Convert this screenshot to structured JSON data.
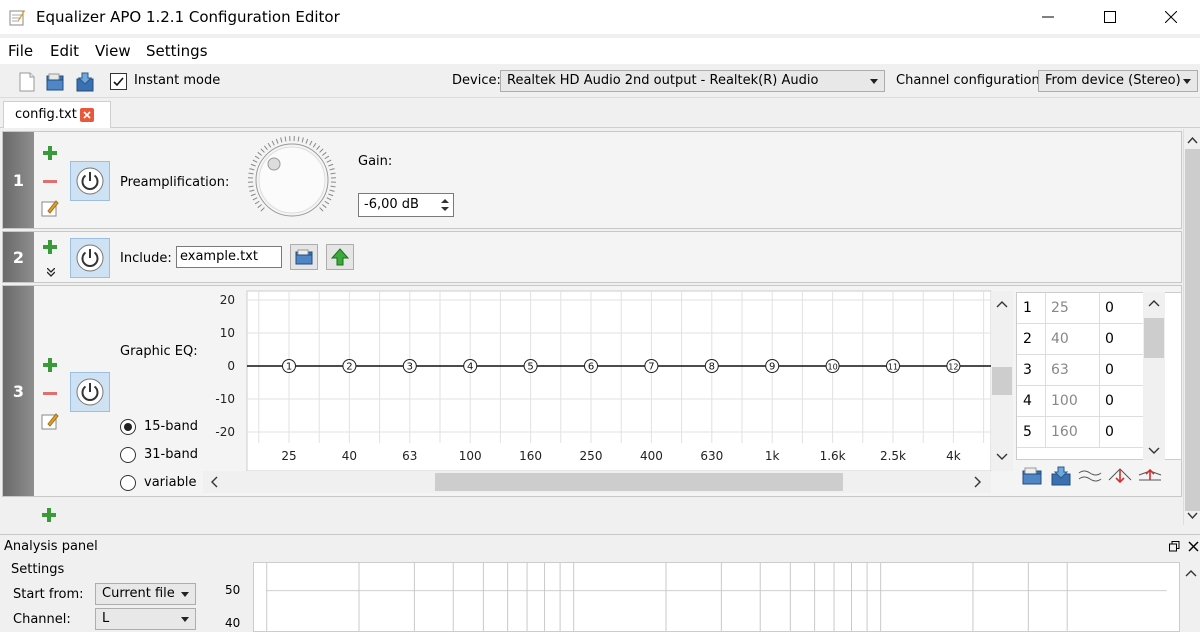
{
  "window": {
    "title": "Equalizer APO 1.2.1 Configuration Editor"
  },
  "menu": {
    "file": "File",
    "edit": "Edit",
    "view": "View",
    "settings": "Settings"
  },
  "toolbar": {
    "instant_mode": "Instant mode",
    "instant_mode_checked": true,
    "device_label": "Device:",
    "device_value": "Realtek HD Audio 2nd output - Realtek(R) Audio",
    "channel_label": "Channel configuration:",
    "channel_value": "From device (Stereo)"
  },
  "tabs": [
    {
      "label": "config.txt"
    }
  ],
  "filters": {
    "row1": {
      "number": "1",
      "label": "Preamplification:",
      "gain_label": "Gain:",
      "gain_value": "-6,00 dB"
    },
    "row2": {
      "number": "2",
      "label": "Include:",
      "file_value": "example.txt"
    },
    "row3": {
      "number": "3",
      "label": "Graphic EQ:",
      "modes": [
        "15-band",
        "31-band",
        "variable"
      ],
      "selected_mode": "15-band",
      "y_ticks": [
        "20",
        "10",
        "0",
        "-10",
        "-20"
      ],
      "x_ticks": [
        "25",
        "40",
        "63",
        "100",
        "160",
        "250",
        "400",
        "630",
        "1k",
        "1.6k",
        "2.5k",
        "4k"
      ],
      "markers": [
        "1",
        "2",
        "3",
        "4",
        "5",
        "6",
        "7",
        "8",
        "9",
        "10",
        "11",
        "12"
      ],
      "table": [
        {
          "index": "1",
          "freq": "25",
          "gain": "0"
        },
        {
          "index": "2",
          "freq": "40",
          "gain": "0"
        },
        {
          "index": "3",
          "freq": "63",
          "gain": "0"
        },
        {
          "index": "4",
          "freq": "100",
          "gain": "0"
        },
        {
          "index": "5",
          "freq": "160",
          "gain": "0"
        }
      ]
    }
  },
  "analysis": {
    "title": "Analysis panel",
    "settings_label": "Settings",
    "start_from_label": "Start from:",
    "start_from_value": "Current file",
    "channel_label": "Channel:",
    "channel_value": "L",
    "y_ticks": [
      "50",
      "40"
    ]
  },
  "colors": {
    "row_number_bg": "#7a7a7a",
    "accent_green": "#3a9a3a",
    "power_bg": "#cfe2f3"
  }
}
